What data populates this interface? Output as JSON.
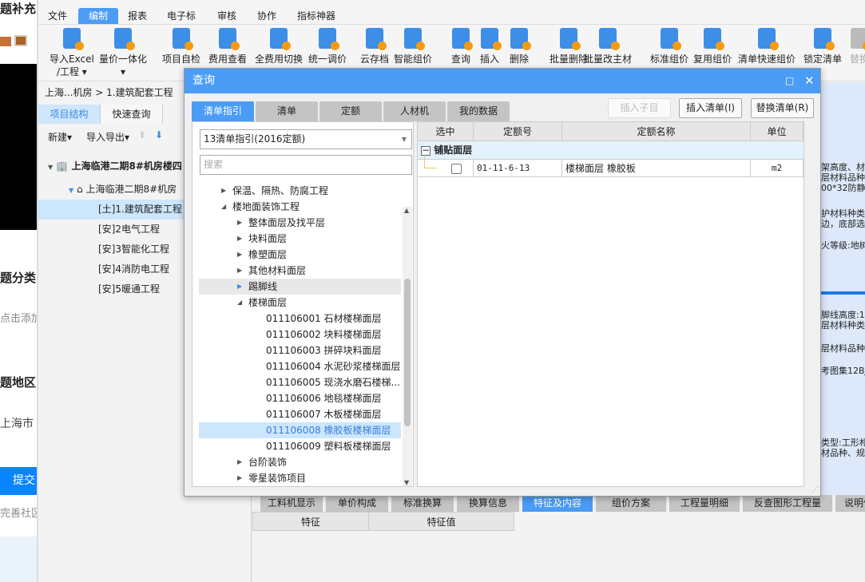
{
  "web_fragment": {
    "title": "题补充",
    "heading1": "题分类",
    "placeholder": "点击添加",
    "heading2": "题地区",
    "region": "上海市",
    "submit": "提交",
    "footer": "完善社区"
  },
  "menu": [
    "文件",
    "编制",
    "报表",
    "电子标",
    "审核",
    "协作",
    "指标神器"
  ],
  "menu_active": 1,
  "toolbar": [
    {
      "label": "导入Excel",
      "sub": "/工程 ▾"
    },
    {
      "label": "量价一体化",
      "sub": "▾"
    },
    {
      "label": "项目自检"
    },
    {
      "label": "费用查看"
    },
    {
      "label": "全费用切换"
    },
    {
      "label": "统一调价"
    },
    {
      "label": "云存档"
    },
    {
      "label": "智能组价"
    },
    {
      "label": "查询"
    },
    {
      "label": "插入"
    },
    {
      "label": "删除"
    },
    {
      "label": "批量删除"
    },
    {
      "label": "批量改主材"
    },
    {
      "label": "标准组价"
    },
    {
      "label": "复用组价"
    },
    {
      "label": "清单快速组价"
    },
    {
      "label": "锁定清单"
    },
    {
      "label": "替换"
    }
  ],
  "left": {
    "breadcrumb": "上海...机房 > 1.建筑配套工程",
    "tabs": [
      "项目结构",
      "快速查询"
    ],
    "actions": {
      "new": "新建▾",
      "import_export": "导入导出▾"
    },
    "tree": [
      {
        "label": "上海临港二期8#机房楼四"
      },
      {
        "label": "上海临港二期8#机房"
      },
      {
        "label": "[土]1.建筑配套工程"
      },
      {
        "label": "[安]2电气工程"
      },
      {
        "label": "[安]3智能化工程"
      },
      {
        "label": "[安]4消防电工程"
      },
      {
        "label": "[安]5暖通工程"
      }
    ]
  },
  "right_fragments": [
    "架高度、材",
    "层材料品种",
    "00*32防静",
    "护材料种类",
    "边，底部选",
    "火等级:地树",
    "脚线高度:1",
    "层材料种类",
    "层材料品种",
    "考图集12BJ",
    "类型:工形札",
    "材品种、规"
  ],
  "dialog": {
    "title": "查询",
    "tabs": [
      "清单指引",
      "清单",
      "定额",
      "人材机",
      "我的数据"
    ],
    "active_tab": 0,
    "buttons": {
      "insert_child": "插入子目",
      "insert_list": "插入清单(I)",
      "replace_list": "替换清单(R)"
    },
    "selector": "13清单指引(2016定额)",
    "search_placeholder": "搜索",
    "tree": [
      {
        "label": "保温、隔热、防腐工程",
        "level": 1,
        "arrow": "collapsed"
      },
      {
        "label": "楼地面装饰工程",
        "level": 1,
        "arrow": "expanded"
      },
      {
        "label": "整体面层及找平层",
        "level": 2,
        "arrow": "collapsed"
      },
      {
        "label": "块料面层",
        "level": 2,
        "arrow": "collapsed"
      },
      {
        "label": "橡塑面层",
        "level": 2,
        "arrow": "collapsed"
      },
      {
        "label": "其他材料面层",
        "level": 2,
        "arrow": "collapsed"
      },
      {
        "label": "踢脚线",
        "level": 2,
        "arrow": "collapsed",
        "state": "hover"
      },
      {
        "label": "楼梯面层",
        "level": 2,
        "arrow": "expanded"
      },
      {
        "label": "011106001  石材楼梯面层",
        "level": 3
      },
      {
        "label": "011106002  块料楼梯面层",
        "level": 3
      },
      {
        "label": "011106003  拼碎块料面层",
        "level": 3
      },
      {
        "label": "011106004  水泥砂浆楼梯面层",
        "level": 3
      },
      {
        "label": "011106005  现浇水磨石楼梯...",
        "level": 3
      },
      {
        "label": "011106006  地毯楼梯面层",
        "level": 3
      },
      {
        "label": "011106007  木板楼梯面层",
        "level": 3
      },
      {
        "label": "011106008  橡胶板楼梯面层",
        "level": 3,
        "state": "selected"
      },
      {
        "label": "011106009  塑料板楼梯面层",
        "level": 3
      },
      {
        "label": "台阶装饰",
        "level": 2,
        "arrow": "collapsed"
      },
      {
        "label": "零星装饰项目",
        "level": 2,
        "arrow": "collapsed"
      },
      {
        "label": "墙、柱面装饰与隔断、幕墙工程",
        "level": 1,
        "arrow": "collapsed"
      }
    ],
    "grid": {
      "headers": [
        "选中",
        "定额号",
        "定额名称",
        "单位"
      ],
      "group": "铺贴面层",
      "rows": [
        {
          "checked": false,
          "code": "01-11-6-13",
          "name": "楼梯面层 橡胶板",
          "unit": "m2"
        }
      ]
    }
  },
  "bottom_tabs": [
    "工料机显示",
    "单价构成",
    "标准换算",
    "换算信息",
    "特征及内容",
    "组价方案",
    "工程量明细",
    "反查图形工程量",
    "说明信"
  ],
  "bottom_active": 4,
  "feature_headers": [
    "特征",
    "特征值"
  ],
  "colors": {
    "accent": "#4a9cf5",
    "selected_row": "#cce6fb"
  }
}
